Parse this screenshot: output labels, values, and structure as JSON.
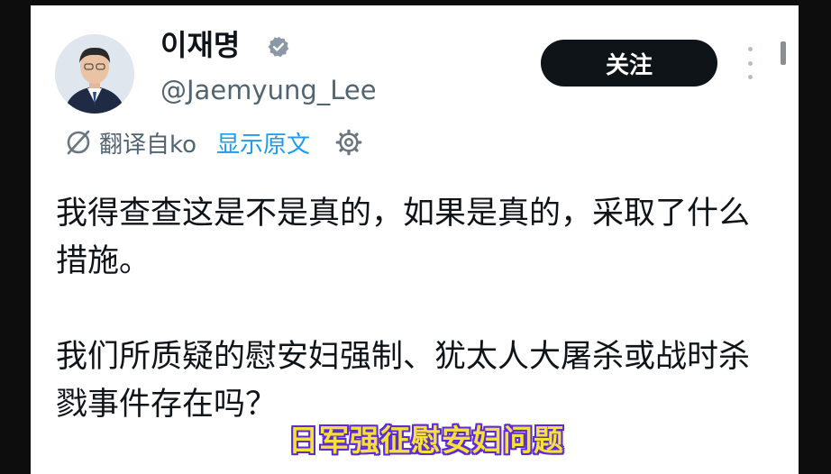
{
  "profile": {
    "display_name": "이재명",
    "handle": "@Jaemyung_Lee"
  },
  "actions": {
    "follow_label": "关注"
  },
  "translation": {
    "translated_from": "翻译自ko",
    "show_original": "显示原文"
  },
  "tweet": {
    "paragraph1": "我得查查这是不是真的，如果是真的，采取了什么措施。",
    "paragraph2": "我们所质疑的慰安妇强制、犹太人大屠杀或战时杀戮事件存在吗？"
  },
  "overlay": {
    "subtitle": "日军强征慰安妇问题"
  },
  "icons": {
    "verified": "verified-badge-icon",
    "more": "more-options-icon",
    "translate": "translate-icon",
    "settings": "gear-icon"
  },
  "colors": {
    "link_blue": "#1d9bf0",
    "text_primary": "#0f1419",
    "text_secondary": "#536471",
    "button_dark": "#0f1419",
    "subtitle_fill": "#f7e03c",
    "subtitle_outline": "#5a2bd6"
  }
}
